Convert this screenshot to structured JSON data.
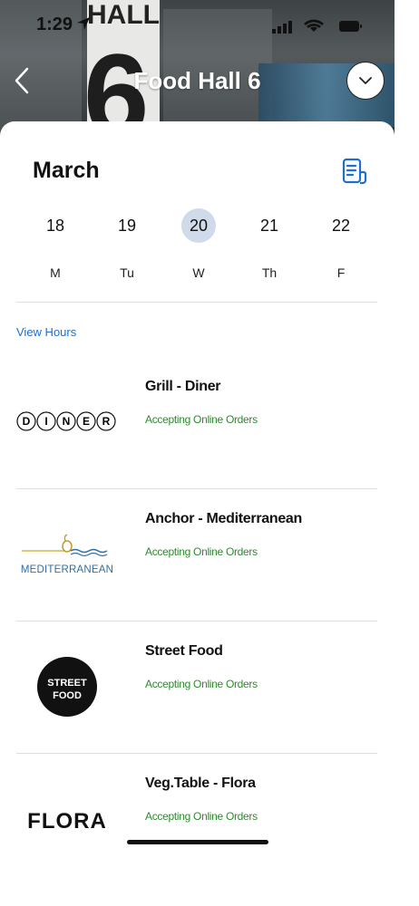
{
  "status_bar": {
    "time": "1:29"
  },
  "hero": {
    "title": "Food Hall 6",
    "sign_text": "HALL",
    "sign_number": "6"
  },
  "calendar": {
    "month": "March",
    "days": [
      {
        "num": "18",
        "weekday": "M",
        "selected": false
      },
      {
        "num": "19",
        "weekday": "Tu",
        "selected": false
      },
      {
        "num": "20",
        "weekday": "W",
        "selected": true
      },
      {
        "num": "21",
        "weekday": "Th",
        "selected": false
      },
      {
        "num": "22",
        "weekday": "F",
        "selected": false
      }
    ]
  },
  "view_hours_label": "View Hours",
  "venues": [
    {
      "name": "Grill - Diner",
      "status": "Accepting Online Orders",
      "logo_text": "DINER",
      "logo_letters": [
        "D",
        "I",
        "N",
        "E",
        "R"
      ]
    },
    {
      "name": "Anchor - Mediterranean",
      "status": "Accepting Online Orders",
      "logo_text": "MEDITERRANEAN"
    },
    {
      "name": "Street Food",
      "status": "Accepting Online Orders",
      "logo_text": [
        "STREET",
        "FOOD"
      ]
    },
    {
      "name": "Veg.Table - Flora",
      "status": "Accepting Online Orders",
      "logo_text": "FLORA"
    }
  ],
  "colors": {
    "accent": "#1f6fd1",
    "status_green": "#2e8a2e",
    "selected_day_bg": "#cfdbea"
  },
  "icons": [
    "back-arrow-icon",
    "chevron-down-icon",
    "menu-document-icon",
    "location-arrow-icon",
    "wifi-icon",
    "battery-icon"
  ]
}
